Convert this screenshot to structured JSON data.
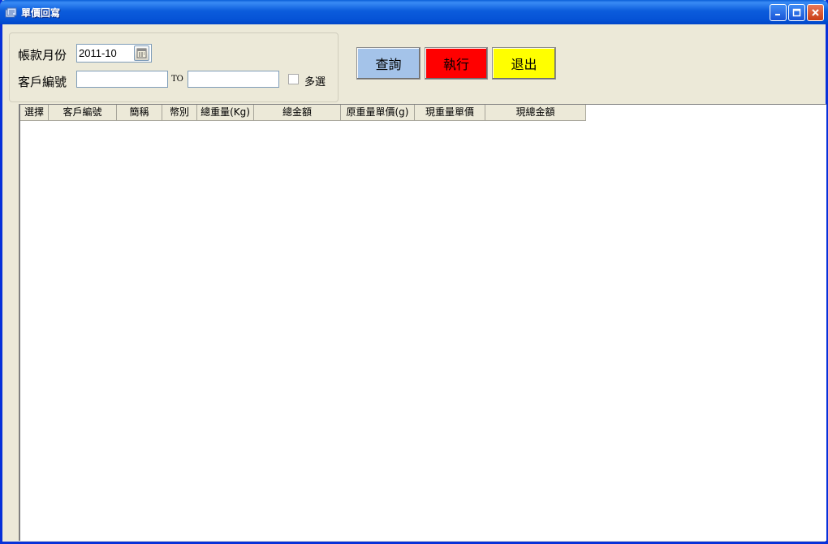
{
  "window": {
    "title": "單價回寫"
  },
  "filter": {
    "month_label": "帳款月份",
    "month_value": "2011-10",
    "customer_label": "客戶編號",
    "customer_from": "",
    "to_label": "TO",
    "customer_to": "",
    "multi_select_label": "多選",
    "multi_select_checked": false
  },
  "buttons": {
    "query": "查詢",
    "run": "執行",
    "exit": "退出",
    "colors": {
      "query": "#a4c3e9",
      "run": "#ff0000",
      "exit": "#ffff00"
    }
  },
  "grid": {
    "columns": [
      "選擇",
      "客戶編號",
      "簡稱",
      "幣別",
      "總重量(Kg)",
      "總金額",
      "原重量單價(g)",
      "現重量單價",
      "現總金額"
    ],
    "rows": []
  }
}
